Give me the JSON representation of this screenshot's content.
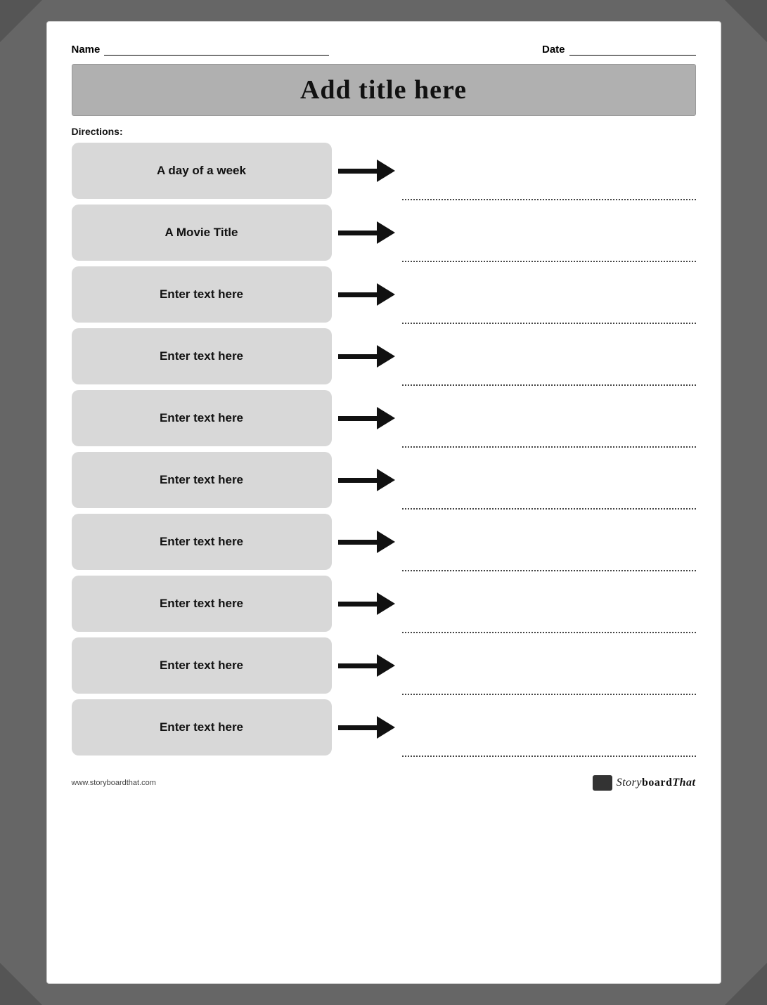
{
  "header": {
    "name_label": "Name",
    "date_label": "Date"
  },
  "title": "Add title here",
  "directions_label": "Directions:",
  "items": [
    {
      "id": 1,
      "label": "A day of a week"
    },
    {
      "id": 2,
      "label": "A Movie Title"
    },
    {
      "id": 3,
      "label": "Enter text here"
    },
    {
      "id": 4,
      "label": "Enter text here"
    },
    {
      "id": 5,
      "label": "Enter text here"
    },
    {
      "id": 6,
      "label": "Enter text here"
    },
    {
      "id": 7,
      "label": "Enter text here"
    },
    {
      "id": 8,
      "label": "Enter text here"
    },
    {
      "id": 9,
      "label": "Enter text here"
    },
    {
      "id": 10,
      "label": "Enter text here"
    }
  ],
  "footer": {
    "url": "www.storyboardthat.com",
    "logo_text": "Storyboard That"
  }
}
